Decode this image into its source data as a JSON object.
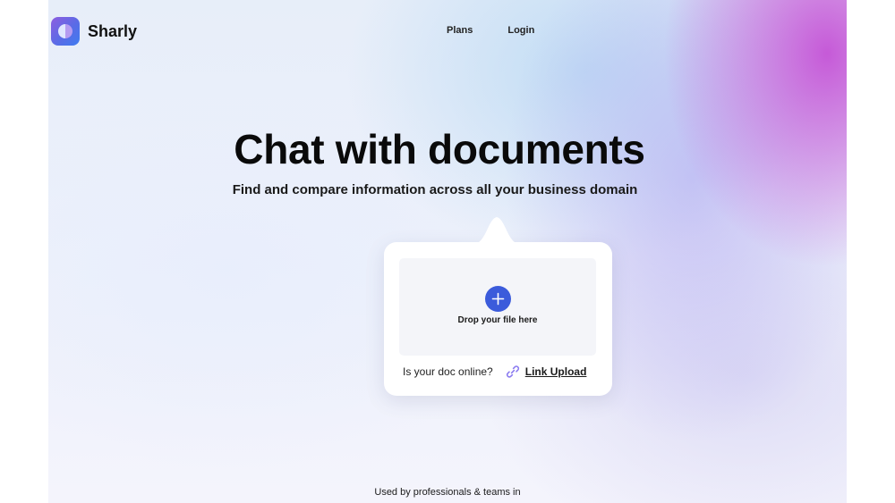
{
  "brand": {
    "name": "Sharly",
    "logo_icon": "sharly-logo-icon",
    "colors": {
      "logo_start": "#8e5de0",
      "logo_end": "#3e7cf0"
    }
  },
  "nav": {
    "plans": "Plans",
    "login": "Login"
  },
  "hero": {
    "title": "Chat with documents",
    "subtitle": "Find and compare information across all your business domain"
  },
  "upload": {
    "plus_icon": "plus-icon",
    "drop_label": "Drop your file here",
    "online_question": "Is your doc online?",
    "link_icon": "link-icon",
    "link_upload": "Link Upload",
    "accent": "#3b5bdb",
    "link_icon_color": "#8b7bf0"
  },
  "footer": {
    "used_by": "Used by professionals & teams in"
  }
}
